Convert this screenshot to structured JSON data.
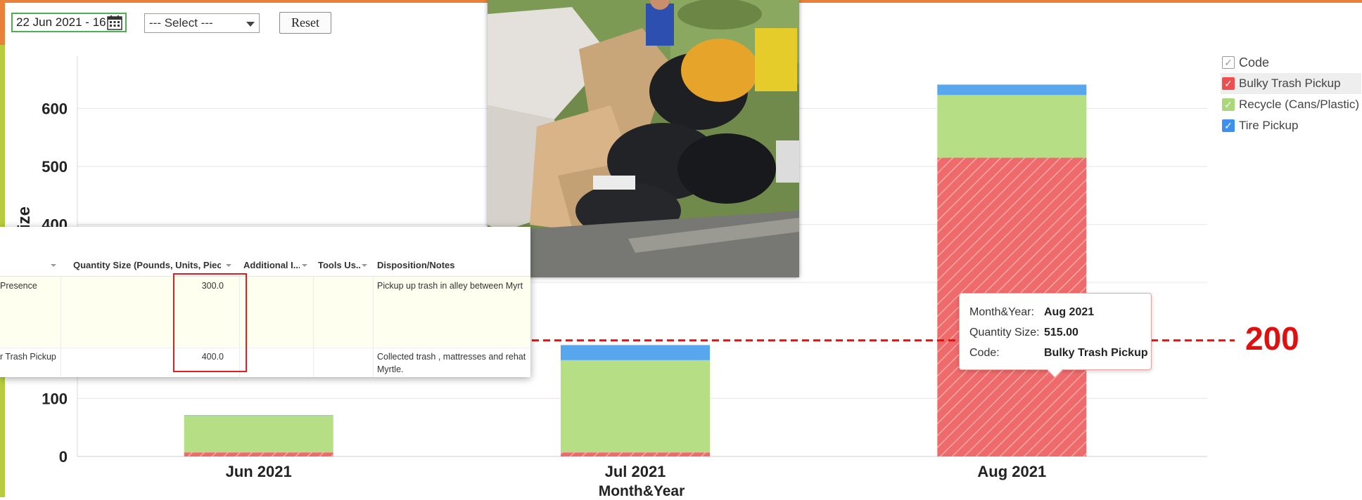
{
  "toolbar": {
    "date_value": "22 Jun 2021 - 16",
    "select_value": "--- Select ---",
    "reset_label": "Reset"
  },
  "chart_data": {
    "type": "bar",
    "stacked": true,
    "categories": [
      "Jun 2021",
      "Jul 2021",
      "Aug 2021"
    ],
    "series": [
      {
        "name": "Bulky Trash Pickup",
        "color": "#ef6b6b",
        "pattern": "hatched",
        "values": [
          7,
          7,
          515
        ]
      },
      {
        "name": "Recycle (Cans/Plastic)",
        "color": "#b5de85",
        "values": [
          63,
          159,
          108
        ]
      },
      {
        "name": "Tire Pickup",
        "color": "#58a6ee",
        "values": [
          1,
          26,
          18
        ]
      }
    ],
    "y_ticks": [
      0,
      100,
      200,
      300,
      400,
      500,
      600
    ],
    "ylim": [
      0,
      690
    ],
    "xlabel": "Month&Year",
    "ylabel": "ize",
    "reference_line": {
      "value": 200,
      "label": "200",
      "color": "#e01010"
    },
    "grid": true,
    "legend_position": "right"
  },
  "legend": {
    "title": "Code",
    "items": [
      {
        "label": "Bulky Trash Pickup",
        "color": "#ef4e4e",
        "highlighted": true
      },
      {
        "label": "Recycle (Cans/Plastic)",
        "color": "#a8d87a",
        "highlighted": false
      },
      {
        "label": "Tire Pickup",
        "color": "#3d8ff0",
        "highlighted": false
      }
    ]
  },
  "tooltip": {
    "month_key": "Month&Year:",
    "month_val": "Aug 2021",
    "qty_key": "Quantity Size:",
    "qty_val": "515.00",
    "code_key": "Code:",
    "code_val": "Bulky Trash Pickup"
  },
  "grid_table": {
    "headers": [
      "Quantity Size (Pounds, Units, Piece...",
      "Additional I...",
      "Tools Us...",
      "Disposition/Notes"
    ],
    "rows": [
      {
        "code": "Presence",
        "qty": "300.0",
        "notes": "Pickup up trash in alley between Myrt"
      },
      {
        "code": "r Trash Pickup",
        "qty": "400.0",
        "notes_1": "Collected trash , mattresses and rehat",
        "notes_2": "Myrtle."
      }
    ]
  }
}
